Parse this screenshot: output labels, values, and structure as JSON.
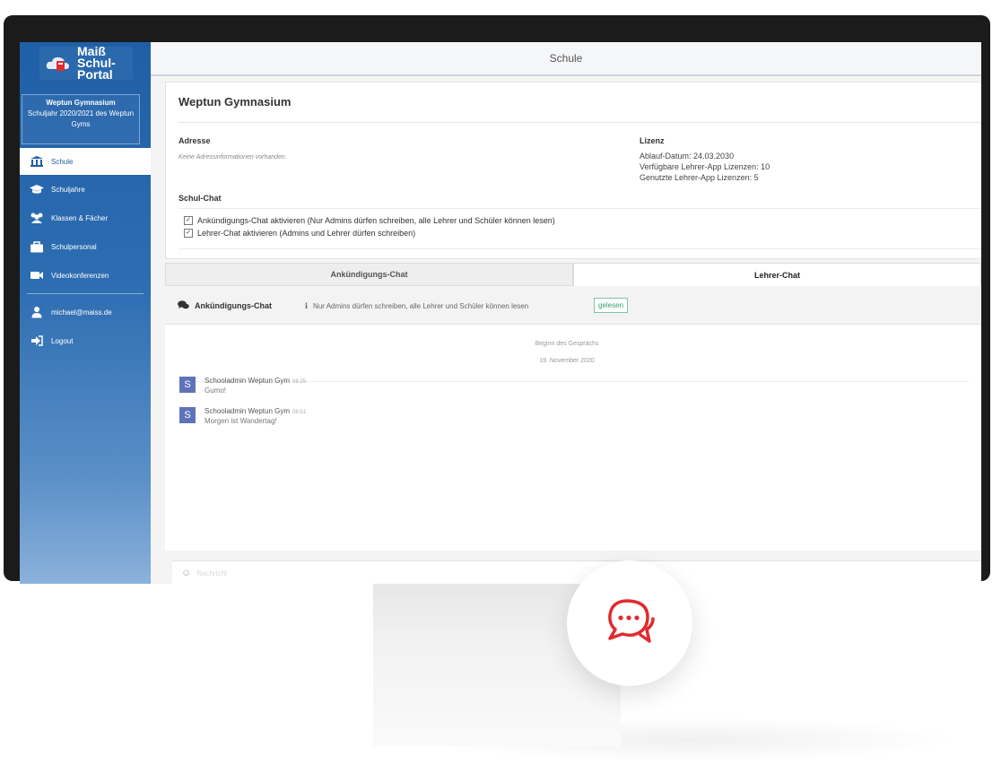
{
  "app": {
    "logo_line1": "Maiß",
    "logo_line2": "Schul-Portal",
    "page_title": "Schule"
  },
  "school_box": {
    "name": "Weptun Gymnasium",
    "year_line": "Schuljahr 2020/2021 des Weptun Gyms"
  },
  "sidebar": {
    "items": [
      {
        "label": "Schule",
        "icon": "school-icon",
        "active": true
      },
      {
        "label": "Schuljahre",
        "icon": "graduation-cap-icon"
      },
      {
        "label": "Klassen & Fächer",
        "icon": "users-icon"
      },
      {
        "label": "Schulpersonal",
        "icon": "briefcase-icon"
      },
      {
        "label": "Videokonferenzen",
        "icon": "video-icon"
      }
    ],
    "user_email": "michael@maiss.de",
    "logout_label": "Logout"
  },
  "school": {
    "title": "Weptun Gymnasium",
    "address_label": "Adresse",
    "address_value": "Keine Adressinformationen vorhanden.",
    "license_label": "Lizenz",
    "license_lines": [
      "Ablauf-Datum: 24.03.2030",
      "Verfügbare Lehrer-App Lizenzen: 10",
      "Genutzte Lehrer-App Lizenzen: 5"
    ],
    "chat_label": "Schul-Chat",
    "options": [
      "Ankündigungs-Chat aktivieren (Nur Admins dürfen schreiben, alle Lehrer und Schüler können lesen)",
      "Lehrer-Chat aktivieren (Admins und Lehrer dürfen schreiben)"
    ]
  },
  "tabs": [
    "Ankündigungs-Chat",
    "Lehrer-Chat"
  ],
  "chat": {
    "title": "Ankündigungs-Chat",
    "info": "Nur Admins dürfen schreiben, alle Lehrer und Schüler können lesen",
    "read_badge": "gelesen",
    "start_text": "Beginn des Gesprächs",
    "date_text": "19. November 2020",
    "messages": [
      {
        "avatar": "S",
        "sender": "Schooladmin Weptun Gym",
        "time": "08:25",
        "text": "Gumo!"
      },
      {
        "avatar": "S",
        "sender": "Schooladmin Weptun Gym",
        "time": "08:51",
        "text": "Morgen ist Wandertag!"
      }
    ],
    "composer_placeholder": "Nachricht"
  },
  "colors": {
    "sidebar": "#1f5fa6",
    "accent": "#e02b2f",
    "avatar": "#5f73b8",
    "read_badge": "#2d9e6e"
  }
}
